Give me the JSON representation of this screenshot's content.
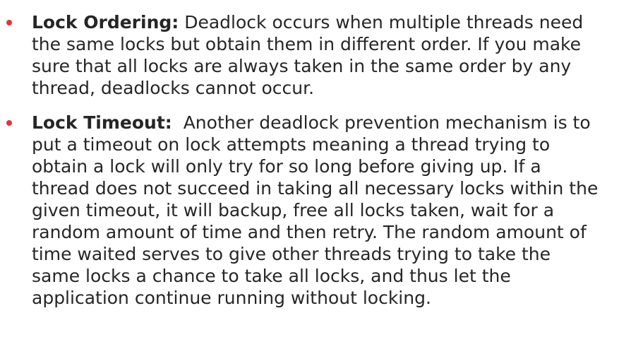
{
  "colors": {
    "text": "#262626",
    "bullet": "#e8323a",
    "background": "#ffffff"
  },
  "bullets": [
    {
      "term": "Lock Ordering:",
      "lines": [
        " Deadlock occurs when multiple threads need",
        "the same locks but obtain them in different order. If you make",
        "sure that all locks are always taken in the same order by any",
        "thread, deadlocks cannot occur."
      ]
    },
    {
      "term": "Lock Timeout:",
      "lines": [
        "  Another deadlock prevention mechanism is to",
        "put a timeout on lock attempts meaning a thread trying to",
        "obtain a lock will only try for so long before giving up. If a",
        "thread does not succeed in taking all necessary locks within the",
        "given timeout, it will backup, free all locks taken, wait for a",
        "random amount of time and then retry. The random amount of",
        "time waited serves to give other threads trying to take the",
        "same locks a chance to take all locks, and thus let the",
        "application continue running without locking."
      ]
    }
  ]
}
